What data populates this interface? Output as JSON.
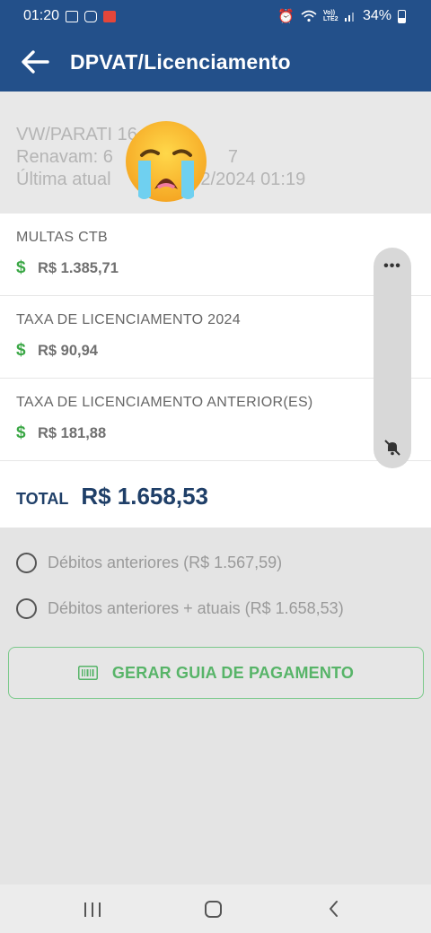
{
  "status_bar": {
    "time": "01:20",
    "network_label": "Vo)) LTE2",
    "battery": "34%"
  },
  "app_bar": {
    "title": "DPVAT/Licenciamento",
    "back_icon": "arrow-left-icon"
  },
  "vehicle": {
    "model": "VW/PARATI 16",
    "renavam": "Renavam: 6",
    "renavam_suffix": "7",
    "update_prefix": "Última atual",
    "update_date": "6/02/2024 01:19"
  },
  "items": [
    {
      "label": "MULTAS CTB",
      "value": "R$ 1.385,71"
    },
    {
      "label": "TAXA DE LICENCIAMENTO 2024",
      "value": "R$ 90,94"
    },
    {
      "label": "TAXA DE LICENCIAMENTO ANTERIOR(ES)",
      "value": "R$ 181,88"
    }
  ],
  "currency_symbol": "$",
  "total": {
    "label": "TOTAL",
    "value": "R$ 1.658,53"
  },
  "floater": {
    "menu": "•••"
  },
  "options": [
    {
      "label": "Débitos anteriores (R$ 1.567,59)",
      "selected": false
    },
    {
      "label": "Débitos anteriores + atuais (R$ 1.658,53)",
      "selected": false
    }
  ],
  "pay_button": {
    "label": "GERAR GUIA DE PAGAMENTO",
    "icon": "barcode-icon"
  },
  "colors": {
    "primary": "#23508a",
    "total_text": "#1f3f68",
    "accent_green": "#3aa745",
    "button_green": "#57b468"
  }
}
